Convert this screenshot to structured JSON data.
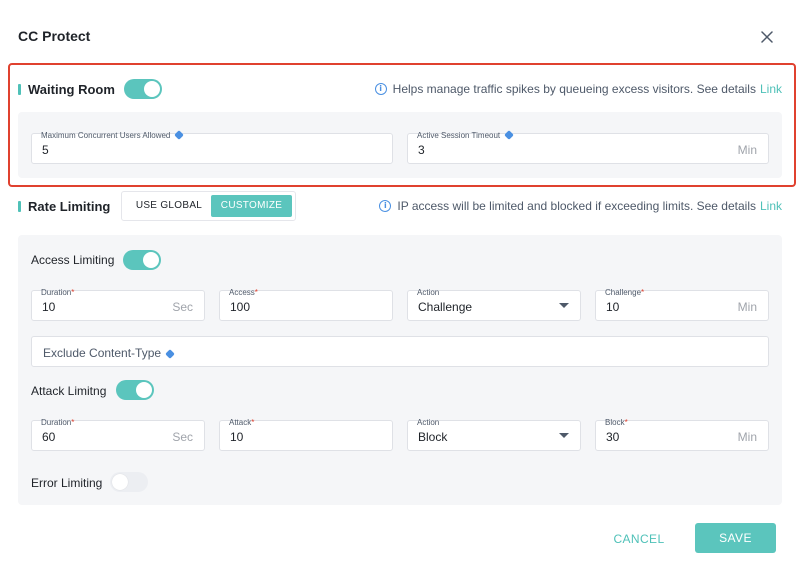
{
  "dialog": {
    "title": "CC Protect"
  },
  "waiting_room": {
    "title": "Waiting Room",
    "enabled": true,
    "info_text": "Helps manage traffic spikes by queueing excess visitors. See details",
    "info_link": "Link",
    "max_users": {
      "label": "Maximum Concurrent Users Allowed",
      "value": "5"
    },
    "session_timeout": {
      "label": "Active Session Timeout",
      "value": "3",
      "unit": "Min"
    }
  },
  "rate_limiting": {
    "title": "Rate Limiting",
    "mode_global": "USE GLOBAL",
    "mode_custom": "CUSTOMIZE",
    "info_text": "IP access will be limited and blocked if exceeding limits. See details",
    "info_link": "Link",
    "access_limiting": {
      "label": "Access Limiting",
      "enabled": true,
      "duration": {
        "label": "Duration",
        "value": "10",
        "unit": "Sec"
      },
      "access": {
        "label": "Access",
        "value": "100"
      },
      "action": {
        "label": "Action",
        "value": "Challenge"
      },
      "challenge": {
        "label": "Challenge",
        "value": "10",
        "unit": "Min"
      }
    },
    "exclude_content_type": {
      "placeholder": "Exclude Content-Type"
    },
    "attack_limiting": {
      "label": "Attack Limitng",
      "enabled": true,
      "duration": {
        "label": "Duration",
        "value": "60",
        "unit": "Sec"
      },
      "attack": {
        "label": "Attack",
        "value": "10"
      },
      "action": {
        "label": "Action",
        "value": "Block"
      },
      "block": {
        "label": "Block",
        "value": "30",
        "unit": "Min"
      }
    },
    "error_limiting": {
      "label": "Error Limiting",
      "enabled": false
    }
  },
  "footer": {
    "cancel": "CANCEL",
    "save": "SAVE"
  },
  "colors": {
    "accent": "#5bc5bd",
    "highlight_border": "#e0412f",
    "required": "#e0412f",
    "info_icon": "#4a90e2"
  },
  "icons": {
    "close": "close-icon",
    "info": "info-icon",
    "hint": "hint-icon",
    "dropdown": "chevron-down-icon"
  }
}
